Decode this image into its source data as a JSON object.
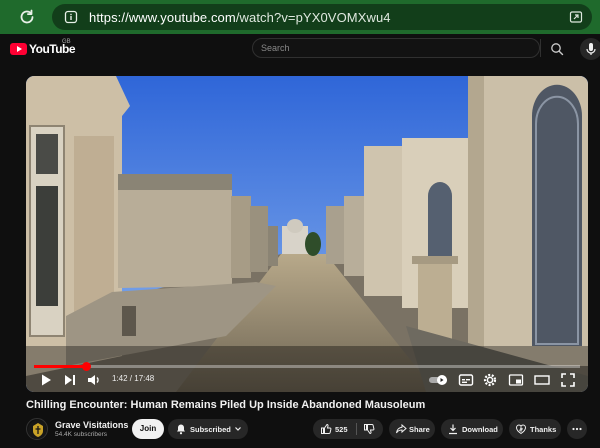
{
  "browser": {
    "url_host": "https://www.youtube.com",
    "url_path": "/watch?v=pYX0VOMXwu4"
  },
  "header": {
    "logo_text": "YouTube",
    "region": "GB",
    "search_placeholder": "Search"
  },
  "player": {
    "time_current": "1:42",
    "time_total": "17:48",
    "time_display": "1:42 / 17:48",
    "progress_fraction": 0.096
  },
  "video": {
    "title": "Chilling Encounter: Human Remains Piled Up Inside Abandoned Mausoleum"
  },
  "channel": {
    "name": "Grave Visitations",
    "subscribers": "54.4K subscribers"
  },
  "actions": {
    "join_label": "Join",
    "subscribed_label": "Subscribed",
    "like_count": "525",
    "share_label": "Share",
    "download_label": "Download",
    "thanks_label": "Thanks"
  },
  "colors": {
    "browser_green": "#1f6a2c",
    "yt_red": "#ff0033",
    "progress_red": "#ff0000",
    "background": "#0f0f0f"
  }
}
